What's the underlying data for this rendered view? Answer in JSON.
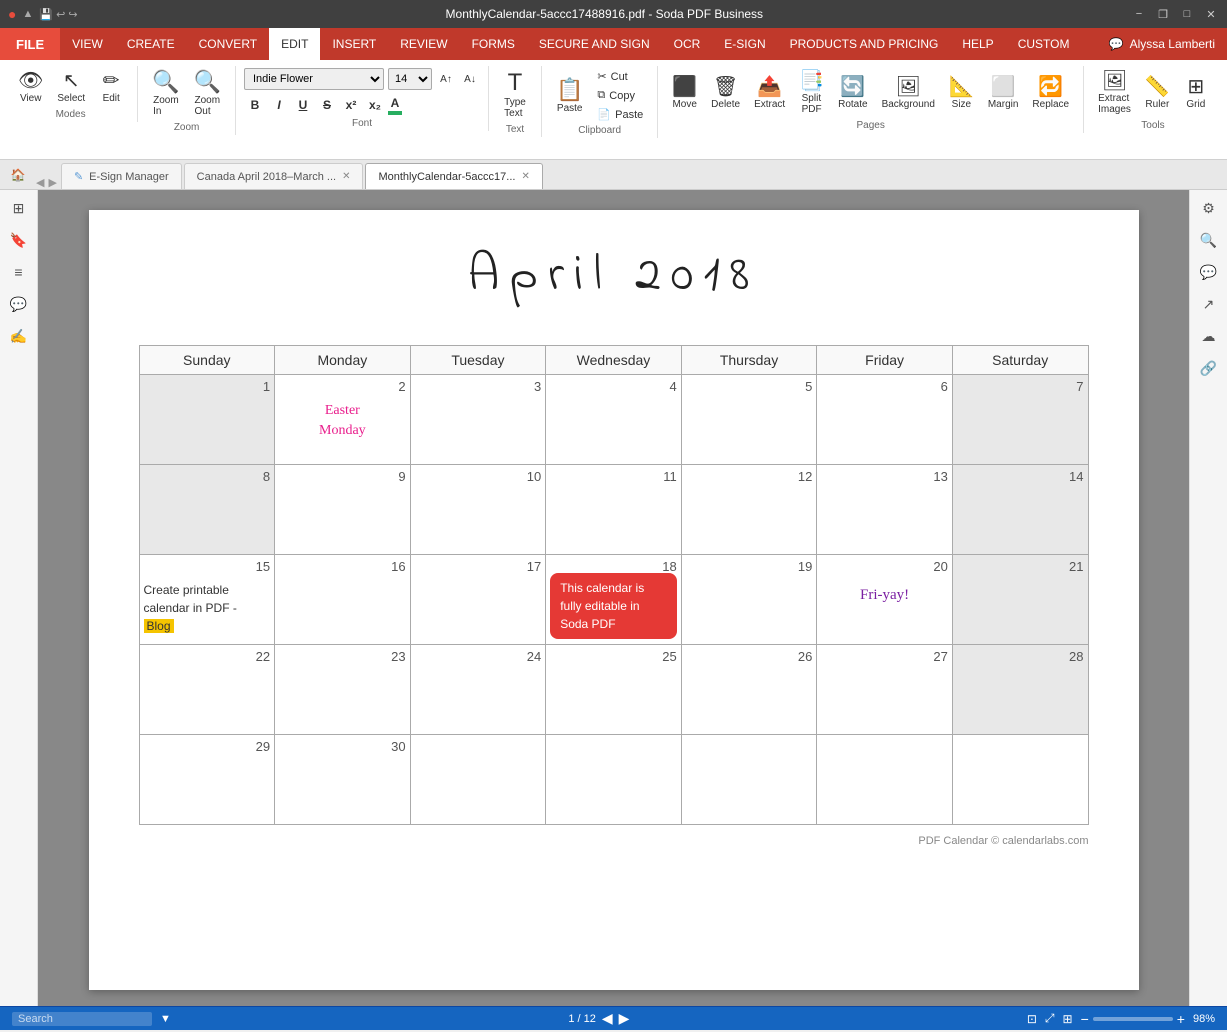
{
  "titlebar": {
    "title": "MonthlyCalendar-5accc17488916.pdf  -  Soda PDF Business",
    "minimize_label": "−",
    "maximize_label": "□",
    "close_label": "✕",
    "restore_label": "❐"
  },
  "menubar": {
    "items": [
      {
        "id": "file",
        "label": "FILE",
        "active": false
      },
      {
        "id": "view",
        "label": "VIEW",
        "active": false
      },
      {
        "id": "create",
        "label": "CREATE",
        "active": false
      },
      {
        "id": "convert",
        "label": "CONVERT",
        "active": false
      },
      {
        "id": "edit",
        "label": "EDIT",
        "active": true
      },
      {
        "id": "insert",
        "label": "INSERT",
        "active": false
      },
      {
        "id": "review",
        "label": "REVIEW",
        "active": false
      },
      {
        "id": "forms",
        "label": "FORMS",
        "active": false
      },
      {
        "id": "secure",
        "label": "SECURE AND SIGN",
        "active": false
      },
      {
        "id": "ocr",
        "label": "OCR",
        "active": false
      },
      {
        "id": "esign",
        "label": "E-SIGN",
        "active": false
      },
      {
        "id": "products",
        "label": "PRODUCTS AND PRICING",
        "active": false
      },
      {
        "id": "help",
        "label": "HELP",
        "active": false
      },
      {
        "id": "custom",
        "label": "CUSTOM",
        "active": false
      }
    ],
    "user": "Alyssa Lamberti"
  },
  "ribbon": {
    "modes": {
      "label": "Modes",
      "buttons": [
        {
          "id": "view-mode",
          "label": "View",
          "icon": "👁"
        },
        {
          "id": "select-mode",
          "label": "Select",
          "icon": "↖"
        },
        {
          "id": "edit-mode",
          "label": "Edit",
          "icon": "✏"
        }
      ]
    },
    "zoom": {
      "label": "Zoom",
      "zoom_in_label": "Zoom\nIn",
      "zoom_out_label": "Zoom\nOut"
    },
    "font": {
      "label": "Font",
      "font_name": "Indie Flower",
      "font_size": "14",
      "bold": "B",
      "italic": "I",
      "underline": "U",
      "strikethrough": "S",
      "superscript": "x²",
      "subscript": "x₂"
    },
    "text": {
      "label": "Text",
      "type_text_label": "Type\nText"
    },
    "clipboard": {
      "label": "Clipboard",
      "cut_label": "Cut",
      "copy_label": "Copy",
      "paste_label": "Paste"
    },
    "pages": {
      "label": "Pages",
      "move_label": "Move",
      "delete_label": "Delete",
      "extract_label": "Extract",
      "split_label": "Split\nPDF",
      "rotate_label": "Rotate",
      "background_label": "Background",
      "size_label": "Size",
      "margin_label": "Margin",
      "replace_label": "Replace"
    },
    "tools": {
      "label": "Tools",
      "ruler_label": "Ruler",
      "grid_label": "Grid",
      "extract_images_label": "Extract\nImages"
    }
  },
  "tabs": {
    "home_title": "Home",
    "items": [
      {
        "id": "esign-manager",
        "label": "E-Sign Manager",
        "closeable": false,
        "active": false
      },
      {
        "id": "canada-calendar",
        "label": "Canada April 2018–March ...",
        "closeable": true,
        "active": false
      },
      {
        "id": "monthly-calendar",
        "label": "MonthlyCalendar-5accc17...",
        "closeable": true,
        "active": true
      }
    ]
  },
  "calendar": {
    "title": "April  2018",
    "headers": [
      "Sunday",
      "Monday",
      "Tuesday",
      "Wednesday",
      "Thursday",
      "Friday",
      "Saturday"
    ],
    "weeks": [
      [
        {
          "day": 1,
          "gray": true,
          "content": ""
        },
        {
          "day": 2,
          "gray": false,
          "content": "easter",
          "text": "Easter\nMonday"
        },
        {
          "day": 3,
          "gray": false,
          "content": ""
        },
        {
          "day": 4,
          "gray": false,
          "content": ""
        },
        {
          "day": 5,
          "gray": false,
          "content": ""
        },
        {
          "day": 6,
          "gray": false,
          "content": ""
        },
        {
          "day": 7,
          "gray": true,
          "content": ""
        }
      ],
      [
        {
          "day": 8,
          "gray": true,
          "content": ""
        },
        {
          "day": 9,
          "gray": false,
          "content": ""
        },
        {
          "day": 10,
          "gray": false,
          "content": ""
        },
        {
          "day": 11,
          "gray": false,
          "content": ""
        },
        {
          "day": 12,
          "gray": false,
          "content": ""
        },
        {
          "day": 13,
          "gray": false,
          "content": ""
        },
        {
          "day": 14,
          "gray": true,
          "content": ""
        }
      ],
      [
        {
          "day": 15,
          "gray": false,
          "content": "blog",
          "text": "Create printable calendar in PDF - Blog"
        },
        {
          "day": 16,
          "gray": false,
          "content": ""
        },
        {
          "day": 17,
          "gray": false,
          "content": ""
        },
        {
          "day": 18,
          "gray": false,
          "content": "rednote",
          "text": "This calendar is fully editable in Soda PDF"
        },
        {
          "day": 19,
          "gray": false,
          "content": ""
        },
        {
          "day": 20,
          "gray": false,
          "content": "friyay",
          "text": "Fri-yay!"
        },
        {
          "day": 21,
          "gray": true,
          "content": ""
        }
      ],
      [
        {
          "day": 22,
          "gray": false,
          "content": ""
        },
        {
          "day": 23,
          "gray": false,
          "content": ""
        },
        {
          "day": 24,
          "gray": false,
          "content": ""
        },
        {
          "day": 25,
          "gray": false,
          "content": ""
        },
        {
          "day": 26,
          "gray": false,
          "content": ""
        },
        {
          "day": 27,
          "gray": false,
          "content": ""
        },
        {
          "day": 28,
          "gray": true,
          "content": ""
        }
      ],
      [
        {
          "day": 29,
          "gray": false,
          "content": ""
        },
        {
          "day": 30,
          "gray": false,
          "content": ""
        },
        {
          "day": null,
          "gray": false,
          "content": ""
        },
        {
          "day": null,
          "gray": false,
          "content": ""
        },
        {
          "day": null,
          "gray": false,
          "content": ""
        },
        {
          "day": null,
          "gray": false,
          "content": ""
        },
        {
          "day": null,
          "gray": false,
          "content": ""
        }
      ]
    ],
    "footer": "PDF Calendar © calendarlabs.com"
  },
  "statusbar": {
    "search_placeholder": "Search",
    "page_info": "1 / 12",
    "zoom_level": "98%"
  }
}
